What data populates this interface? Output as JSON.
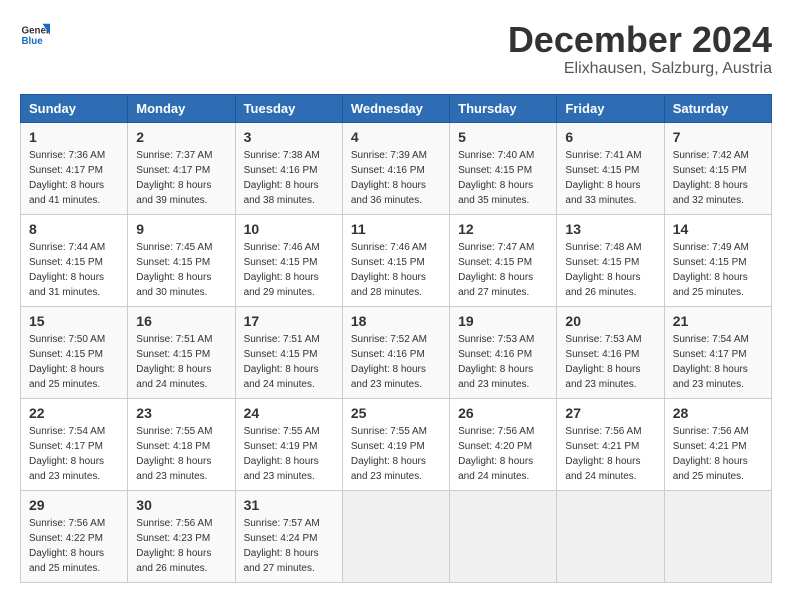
{
  "logo": {
    "general": "General",
    "blue": "Blue"
  },
  "title": {
    "month_year": "December 2024",
    "location": "Elixhausen, Salzburg, Austria"
  },
  "headers": [
    "Sunday",
    "Monday",
    "Tuesday",
    "Wednesday",
    "Thursday",
    "Friday",
    "Saturday"
  ],
  "weeks": [
    [
      {
        "day": "1",
        "sunrise": "7:36 AM",
        "sunset": "4:17 PM",
        "daylight": "8 hours and 41 minutes."
      },
      {
        "day": "2",
        "sunrise": "7:37 AM",
        "sunset": "4:17 PM",
        "daylight": "8 hours and 39 minutes."
      },
      {
        "day": "3",
        "sunrise": "7:38 AM",
        "sunset": "4:16 PM",
        "daylight": "8 hours and 38 minutes."
      },
      {
        "day": "4",
        "sunrise": "7:39 AM",
        "sunset": "4:16 PM",
        "daylight": "8 hours and 36 minutes."
      },
      {
        "day": "5",
        "sunrise": "7:40 AM",
        "sunset": "4:15 PM",
        "daylight": "8 hours and 35 minutes."
      },
      {
        "day": "6",
        "sunrise": "7:41 AM",
        "sunset": "4:15 PM",
        "daylight": "8 hours and 33 minutes."
      },
      {
        "day": "7",
        "sunrise": "7:42 AM",
        "sunset": "4:15 PM",
        "daylight": "8 hours and 32 minutes."
      }
    ],
    [
      {
        "day": "8",
        "sunrise": "7:44 AM",
        "sunset": "4:15 PM",
        "daylight": "8 hours and 31 minutes."
      },
      {
        "day": "9",
        "sunrise": "7:45 AM",
        "sunset": "4:15 PM",
        "daylight": "8 hours and 30 minutes."
      },
      {
        "day": "10",
        "sunrise": "7:46 AM",
        "sunset": "4:15 PM",
        "daylight": "8 hours and 29 minutes."
      },
      {
        "day": "11",
        "sunrise": "7:46 AM",
        "sunset": "4:15 PM",
        "daylight": "8 hours and 28 minutes."
      },
      {
        "day": "12",
        "sunrise": "7:47 AM",
        "sunset": "4:15 PM",
        "daylight": "8 hours and 27 minutes."
      },
      {
        "day": "13",
        "sunrise": "7:48 AM",
        "sunset": "4:15 PM",
        "daylight": "8 hours and 26 minutes."
      },
      {
        "day": "14",
        "sunrise": "7:49 AM",
        "sunset": "4:15 PM",
        "daylight": "8 hours and 25 minutes."
      }
    ],
    [
      {
        "day": "15",
        "sunrise": "7:50 AM",
        "sunset": "4:15 PM",
        "daylight": "8 hours and 25 minutes."
      },
      {
        "day": "16",
        "sunrise": "7:51 AM",
        "sunset": "4:15 PM",
        "daylight": "8 hours and 24 minutes."
      },
      {
        "day": "17",
        "sunrise": "7:51 AM",
        "sunset": "4:15 PM",
        "daylight": "8 hours and 24 minutes."
      },
      {
        "day": "18",
        "sunrise": "7:52 AM",
        "sunset": "4:16 PM",
        "daylight": "8 hours and 23 minutes."
      },
      {
        "day": "19",
        "sunrise": "7:53 AM",
        "sunset": "4:16 PM",
        "daylight": "8 hours and 23 minutes."
      },
      {
        "day": "20",
        "sunrise": "7:53 AM",
        "sunset": "4:16 PM",
        "daylight": "8 hours and 23 minutes."
      },
      {
        "day": "21",
        "sunrise": "7:54 AM",
        "sunset": "4:17 PM",
        "daylight": "8 hours and 23 minutes."
      }
    ],
    [
      {
        "day": "22",
        "sunrise": "7:54 AM",
        "sunset": "4:17 PM",
        "daylight": "8 hours and 23 minutes."
      },
      {
        "day": "23",
        "sunrise": "7:55 AM",
        "sunset": "4:18 PM",
        "daylight": "8 hours and 23 minutes."
      },
      {
        "day": "24",
        "sunrise": "7:55 AM",
        "sunset": "4:19 PM",
        "daylight": "8 hours and 23 minutes."
      },
      {
        "day": "25",
        "sunrise": "7:55 AM",
        "sunset": "4:19 PM",
        "daylight": "8 hours and 23 minutes."
      },
      {
        "day": "26",
        "sunrise": "7:56 AM",
        "sunset": "4:20 PM",
        "daylight": "8 hours and 24 minutes."
      },
      {
        "day": "27",
        "sunrise": "7:56 AM",
        "sunset": "4:21 PM",
        "daylight": "8 hours and 24 minutes."
      },
      {
        "day": "28",
        "sunrise": "7:56 AM",
        "sunset": "4:21 PM",
        "daylight": "8 hours and 25 minutes."
      }
    ],
    [
      {
        "day": "29",
        "sunrise": "7:56 AM",
        "sunset": "4:22 PM",
        "daylight": "8 hours and 25 minutes."
      },
      {
        "day": "30",
        "sunrise": "7:56 AM",
        "sunset": "4:23 PM",
        "daylight": "8 hours and 26 minutes."
      },
      {
        "day": "31",
        "sunrise": "7:57 AM",
        "sunset": "4:24 PM",
        "daylight": "8 hours and 27 minutes."
      },
      null,
      null,
      null,
      null
    ]
  ]
}
